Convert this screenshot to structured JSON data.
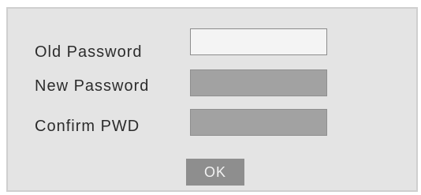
{
  "form": {
    "old_password": {
      "label": "Old Password",
      "value": ""
    },
    "new_password": {
      "label": "New Password",
      "value": ""
    },
    "confirm_password": {
      "label": "Confirm PWD",
      "value": ""
    },
    "ok_label": "OK"
  },
  "colors": {
    "dialog_background": "#e4e4e4",
    "active_field": "#f4f4f4",
    "inactive_field": "#a2a2a2",
    "ok_button": "#8e8e8e"
  }
}
